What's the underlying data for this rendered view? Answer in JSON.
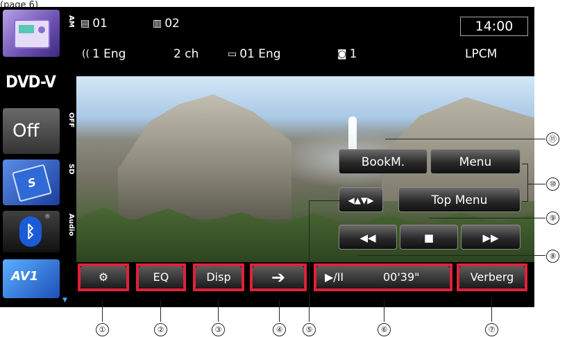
{
  "caption": "(page 6)",
  "sources": {
    "am_label": "AM",
    "dvd_label": "DVD-V",
    "off_label": "Off",
    "off_side": "OFF",
    "sd_label": "SD",
    "sd_icon_text": "S",
    "bt_side": "Audio",
    "bt_reg": "®",
    "av_label": "AV1"
  },
  "info": {
    "chapter": "01",
    "title_num": "02",
    "audio": "1 Eng",
    "channels": "2 ch",
    "subtitle": "01 Eng",
    "angle": "1",
    "format": "LPCM",
    "clock": "14:00"
  },
  "controls": {
    "bookmark": "BookM.",
    "menu": "Menu",
    "top_menu": "Top Menu",
    "cursor": "◀▲▼▶",
    "prev": "◀◀",
    "stop": "■",
    "next": "▶▶",
    "settings": "⚙",
    "eq": "EQ",
    "disp": "Disp",
    "arrow": "➔",
    "play_pause": "▶/II",
    "time": "00'39\"",
    "hide": "Verberg"
  },
  "callouts": [
    "①",
    "②",
    "③",
    "④",
    "⑤",
    "⑥",
    "⑦",
    "⑧",
    "⑨",
    "⑩",
    "⑪"
  ],
  "colors": {
    "highlight": "#e0213a",
    "accent_blue": "#4fa7ff"
  }
}
